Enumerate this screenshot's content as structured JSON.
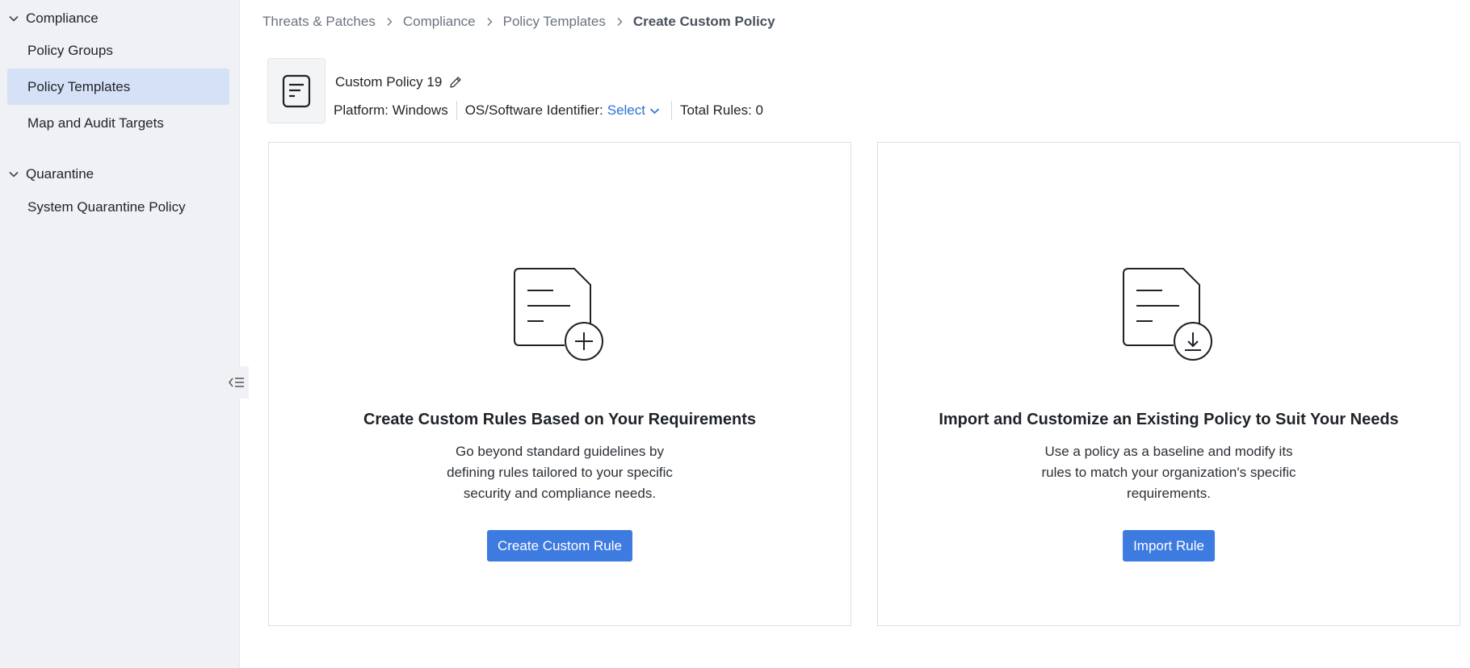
{
  "sidebar": {
    "sections": [
      {
        "label": "Compliance",
        "items": [
          {
            "label": "Policy Groups",
            "active": false
          },
          {
            "label": "Policy Templates",
            "active": true
          },
          {
            "label": "Map and Audit Targets",
            "active": false
          }
        ]
      },
      {
        "label": "Quarantine",
        "items": [
          {
            "label": "System Quarantine Policy",
            "active": false
          }
        ]
      }
    ]
  },
  "breadcrumb": [
    "Threats & Patches",
    "Compliance",
    "Policy Templates",
    "Create Custom Policy"
  ],
  "policy": {
    "name": "Custom Policy 19",
    "platform": "Platform: Windows",
    "os_label": "OS/Software Identifier:",
    "os_value": "Select",
    "total_rules": "Total Rules: 0"
  },
  "cards": {
    "create": {
      "title": "Create Custom Rules Based on Your Requirements",
      "desc_lines": [
        "Go beyond standard guidelines by",
        "defining rules tailored to your specific",
        "security and compliance needs."
      ],
      "button": "Create Custom Rule"
    },
    "import": {
      "title": "Import and Customize an Existing Policy to Suit Your Needs",
      "desc_lines": [
        "Use a policy as a baseline and modify its",
        "rules to match your organization's specific",
        "requirements."
      ],
      "button": "Import Rule"
    }
  },
  "colors": {
    "accent": "#3e7be0",
    "link": "#2f6fd8",
    "sidebar_bg": "#eff1f4",
    "active_item_bg": "#d5e1f6"
  },
  "icons": {
    "section_toggle": "chevron-down-icon",
    "breadcrumb_separator": "chevron-right-icon",
    "policy": "document-icon",
    "edit": "pencil-icon",
    "dropdown": "chevron-down-icon",
    "collapse": "collapse-sidebar-icon",
    "create_illustration": "document-plus-icon",
    "import_illustration": "document-download-icon"
  }
}
